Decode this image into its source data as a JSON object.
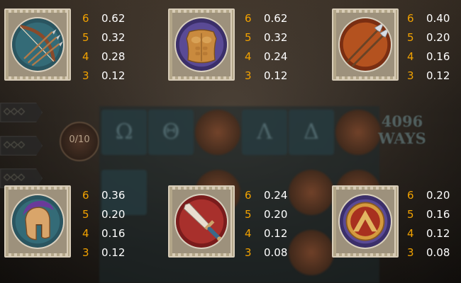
{
  "colors": {
    "count": "#f2a200",
    "value": "#ffffff",
    "frame": "#d7ccb8"
  },
  "background": {
    "counter_text": "0/10",
    "ways_line1": "4096",
    "ways_line2": "WAYS",
    "reel_glyphs": [
      "Ω",
      "Θ",
      "Λ",
      "Δ"
    ]
  },
  "paytable": [
    {
      "name": "bow",
      "icon": "bow-and-arrows-icon",
      "pays": [
        {
          "count": "6",
          "value": "0.62"
        },
        {
          "count": "5",
          "value": "0.32"
        },
        {
          "count": "4",
          "value": "0.28"
        },
        {
          "count": "3",
          "value": "0.12"
        }
      ]
    },
    {
      "name": "armor",
      "icon": "breastplate-icon",
      "pays": [
        {
          "count": "6",
          "value": "0.62"
        },
        {
          "count": "5",
          "value": "0.32"
        },
        {
          "count": "4",
          "value": "0.24"
        },
        {
          "count": "3",
          "value": "0.12"
        }
      ]
    },
    {
      "name": "spears",
      "icon": "spears-icon",
      "pays": [
        {
          "count": "6",
          "value": "0.40"
        },
        {
          "count": "5",
          "value": "0.20"
        },
        {
          "count": "4",
          "value": "0.16"
        },
        {
          "count": "3",
          "value": "0.12"
        }
      ]
    },
    {
      "name": "helmet",
      "icon": "helmet-icon",
      "pays": [
        {
          "count": "6",
          "value": "0.36"
        },
        {
          "count": "5",
          "value": "0.20"
        },
        {
          "count": "4",
          "value": "0.16"
        },
        {
          "count": "3",
          "value": "0.12"
        }
      ]
    },
    {
      "name": "sword",
      "icon": "sword-icon",
      "pays": [
        {
          "count": "6",
          "value": "0.24"
        },
        {
          "count": "5",
          "value": "0.20"
        },
        {
          "count": "4",
          "value": "0.12"
        },
        {
          "count": "3",
          "value": "0.08"
        }
      ]
    },
    {
      "name": "shield",
      "icon": "shield-icon",
      "pays": [
        {
          "count": "6",
          "value": "0.20"
        },
        {
          "count": "5",
          "value": "0.16"
        },
        {
          "count": "4",
          "value": "0.12"
        },
        {
          "count": "3",
          "value": "0.08"
        }
      ]
    }
  ]
}
